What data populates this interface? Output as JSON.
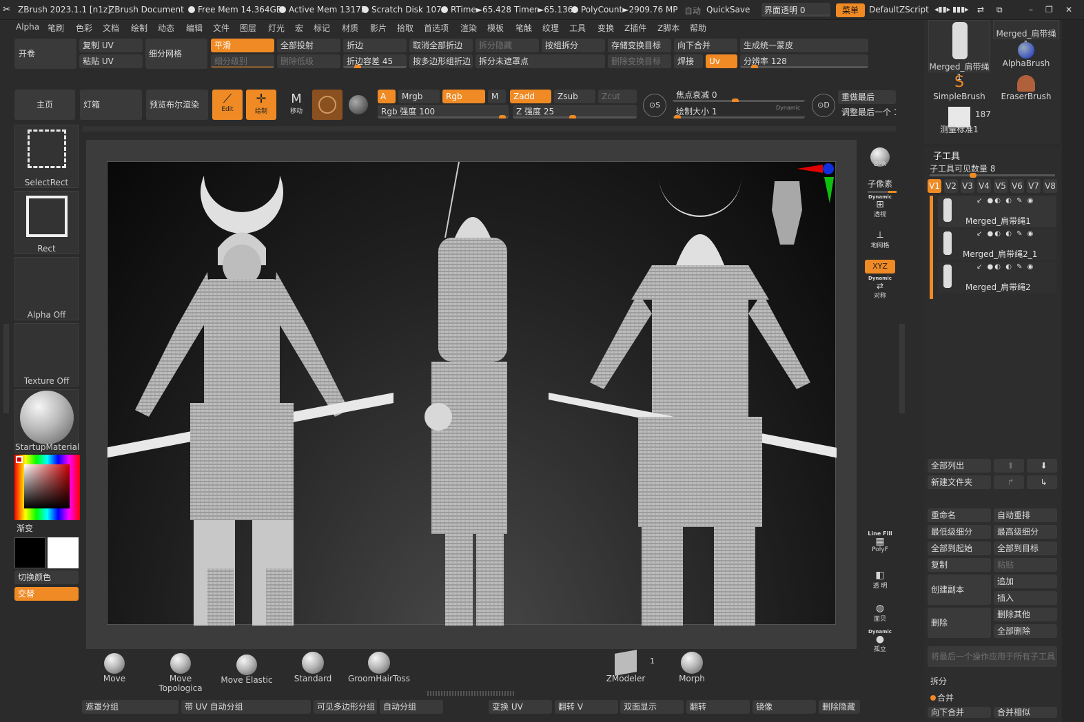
{
  "titlebar": {
    "app": "ZBrush 2023.1.1 [n1z]",
    "doc": "ZBrush Document",
    "free_mem": "Free Mem 14.364GB",
    "active_mem": "Active Mem 13175",
    "scratch": "Scratch Disk 107",
    "rtime": "RTime►65.428 Timer►65.136",
    "polycount": "PolyCount►2909.76 MP",
    "auto": "自动",
    "quicksave": "QuickSave",
    "transparency": "界面透明 0",
    "menu": "菜单",
    "script": "DefaultZScript"
  },
  "menubar": [
    "Alpha",
    "笔刷",
    "色彩",
    "文档",
    "绘制",
    "动态",
    "编辑",
    "文件",
    "图层",
    "灯光",
    "宏",
    "标记",
    "材质",
    "影片",
    "拾取",
    "首选项",
    "渲染",
    "模板",
    "笔触",
    "纹理",
    "工具",
    "变换",
    "Z插件",
    "Z脚本",
    "帮助"
  ],
  "top_palette": {
    "open": "开卷",
    "copy_uv": "复制 UV",
    "paste_uv": "粘贴 UV",
    "subdiv_mesh": "细分网格",
    "smooth": "平滑",
    "subdiv_level": "细分级别",
    "all_project": "全部投射",
    "delete_lower": "删除低级",
    "crease": "折边",
    "crease_tol": "折边容差 45",
    "uncrease_all": "取消全部折边",
    "crease_pg": "按多边形组折边",
    "split_hidden": "拆分隐藏",
    "split_unmasked": "拆分未遮罩点",
    "group_split": "按组拆分",
    "del_morph": "删除变换目标",
    "store_morph": "存储变换目标",
    "merge_down": "向下合并",
    "weld": "焊接",
    "uv": "Uv",
    "gen_skin": "生成统一蒙皮",
    "resolution": "分辨率 128"
  },
  "toolbar": {
    "home": "主页",
    "lightbox": "灯箱",
    "preview_bool": "预览布尔渲染",
    "edit": "Edit",
    "draw": "绘制",
    "move_label": "移动",
    "a": "A",
    "mrgb": "Mrgb",
    "rgb": "Rgb",
    "m": "M",
    "rgb_intensity": "Rgb 强度 100",
    "zadd": "Zadd",
    "zsub": "Zsub",
    "zcut": "Zcut",
    "z_intensity": "Z 强度 25",
    "focal": "焦点衰减 0",
    "draw_size": "绘制大小 1",
    "dynamic": "Dynamic",
    "redo_last": "重做最后",
    "adjust_last": "调整最后一个 1"
  },
  "left_shelf": {
    "selectrect": "SelectRect",
    "rect": "Rect",
    "alpha_off": "Alpha Off",
    "texture_off": "Texture Off",
    "material": "StartupMaterial",
    "gradient": "渐变",
    "switch_color": "切换颜色",
    "alternate": "交替"
  },
  "right_shelf": {
    "bpr": "BPR",
    "subpixel": "子像素",
    "persp": "透视",
    "floor": "地网格",
    "xyz": "XYZ",
    "dynamic": "Dynamic",
    "symmetry": "对称",
    "linefill": "Line Fill",
    "polyf": "PolyF",
    "transp": "透 明",
    "ghost": "面贝",
    "solo": "孤立"
  },
  "brushes": [
    "Move",
    "Move Topologica",
    "Move Elastic",
    "Standard",
    "GroomHairToss",
    "ZModeler",
    "Morph"
  ],
  "zmodeler_count": "1",
  "bottom_bar": [
    "遮罩分组",
    "带 UV 自动分组",
    "可见多边形分组",
    "自动分组",
    "变换 UV",
    "翻转 V",
    "双面显示",
    "翻转",
    "镜像",
    "删除隐藏"
  ],
  "tool_panel": {
    "thumbs": [
      "Merged_肩带绳1",
      "Merged_肩带绳1",
      "AlphaBrush",
      "SimpleBrush",
      "EraserBrush",
      "测量标准1"
    ],
    "count": "187",
    "subtool_title": "子工具",
    "visible_count": "子工具可见数量 8",
    "tabs": [
      "V1",
      "V2",
      "V3",
      "V4",
      "V5",
      "V6",
      "V7",
      "V8"
    ],
    "subtools": [
      "Merged_肩带绳1",
      "Merged_肩带绳2_1",
      "Merged_肩带绳2"
    ],
    "list_all": "全部列出",
    "new_folder": "新建文件夹",
    "rename": "重命名",
    "auto_reorder": "自动重排",
    "lowest_sub": "最低级细分",
    "highest_sub": "最高级细分",
    "all_to_start": "全部到起始",
    "all_to_target": "全部到目标",
    "duplicate": "复制",
    "paste": "粘贴",
    "create_copy": "创建副本",
    "append": "追加",
    "insert": "插入",
    "delete": "删除",
    "delete_other": "删除其他",
    "delete_all": "全部删除",
    "apply_last": "将最后一个操作应用于所有子工具",
    "split": "拆分",
    "merge": "合并",
    "merge_down2": "向下合并",
    "merge_similar": "合并相似"
  },
  "colors": {
    "accent": "#f08a24",
    "panel": "#2b2b2b",
    "button": "#3a3a3a"
  }
}
